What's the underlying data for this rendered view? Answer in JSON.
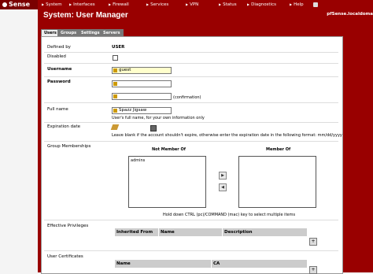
{
  "nav": {
    "logo": "Sense",
    "items": [
      "System",
      "Interfaces",
      "Firewall",
      "Services",
      "VPN",
      "Status",
      "Diagnostics",
      "Help"
    ]
  },
  "header": {
    "title": "System: User Manager",
    "hostname": "pfSense.localdoma"
  },
  "tabs": [
    "Users",
    "Groups",
    "Settings",
    "Servers"
  ],
  "form": {
    "defined_by": {
      "label": "Defined by",
      "value": "USER"
    },
    "disabled": {
      "label": "Disabled"
    },
    "username": {
      "label": "Username",
      "value": "guest"
    },
    "password": {
      "label": "Password",
      "confirm_note": "(confirmation)"
    },
    "fullname": {
      "label": "Full name",
      "value": "Spazz Jigsaw",
      "hint": "User's full name, for your own information only"
    },
    "expiration": {
      "label": "Expiration date",
      "hint": "Leave blank if the account shouldn't expire, otherwise enter the expiration date in the following format: mm/dd/yyyy"
    },
    "groups": {
      "label": "Group Memberships",
      "not_member_header": "Not Member Of",
      "member_header": "Member Of",
      "not_member_items": [
        "admins"
      ],
      "hint": "Hold down CTRL (pc)/COMMAND (mac) key to select multiple items"
    },
    "privileges": {
      "label": "Effective Privileges",
      "columns": [
        "Inherited From",
        "Name",
        "Description"
      ]
    },
    "certificates": {
      "label": "User Certificates",
      "columns": [
        "Name",
        "CA"
      ]
    }
  },
  "colors": {
    "brand": "#990000",
    "tab_inactive": "#777777",
    "input_highlight": "#ffffcc"
  }
}
